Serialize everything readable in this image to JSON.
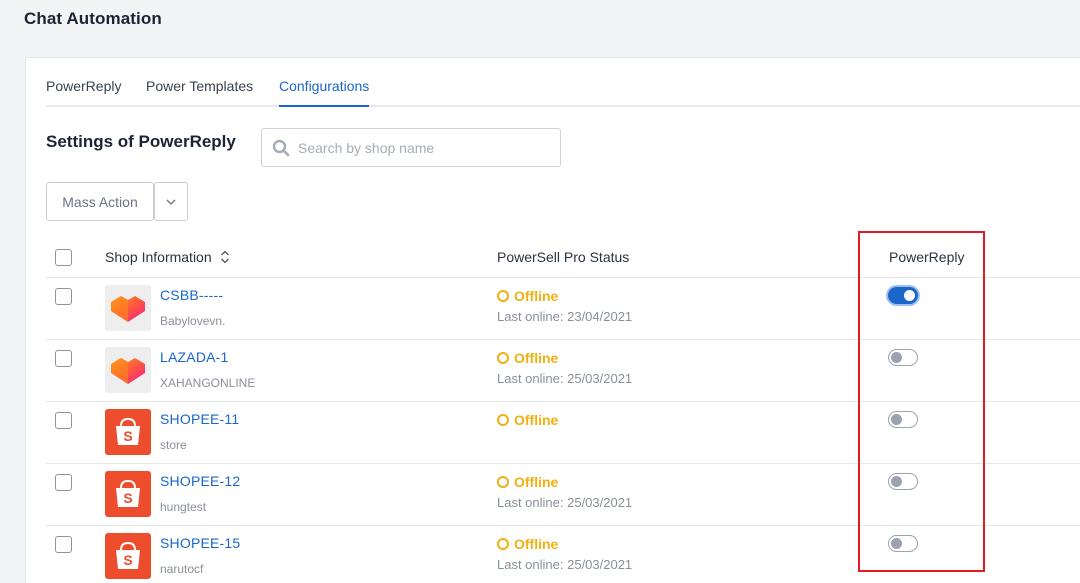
{
  "page": {
    "title": "Chat Automation"
  },
  "tabs": [
    {
      "label": "PowerReply",
      "active": false
    },
    {
      "label": "Power Templates",
      "active": false
    },
    {
      "label": "Configurations",
      "active": true
    }
  ],
  "section": {
    "title": "Settings of PowerReply"
  },
  "search": {
    "placeholder": "Search by shop name",
    "value": ""
  },
  "mass_action": {
    "label": "Mass Action"
  },
  "table": {
    "headers": {
      "shop_info": "Shop Information",
      "status": "PowerSell Pro Status",
      "power_reply": "PowerReply"
    },
    "rows": [
      {
        "name": "CSBB-----",
        "sub": "Babylovevn.",
        "platform": "lazada",
        "status": "Offline",
        "last_online": "Last online: 23/04/2021",
        "power_reply": true
      },
      {
        "name": "LAZADA-1",
        "sub": "XAHANGONLINE",
        "platform": "lazada",
        "status": "Offline",
        "last_online": "Last online: 25/03/2021",
        "power_reply": false
      },
      {
        "name": "SHOPEE-11",
        "sub": "store",
        "platform": "shopee",
        "status": "Offline",
        "last_online": "",
        "power_reply": false
      },
      {
        "name": "SHOPEE-12",
        "sub": "hungtest",
        "platform": "shopee",
        "status": "Offline",
        "last_online": "Last online: 25/03/2021",
        "power_reply": false
      },
      {
        "name": "SHOPEE-15",
        "sub": "narutocf",
        "platform": "shopee",
        "status": "Offline",
        "last_online": "Last online: 25/03/2021",
        "power_reply": false
      }
    ]
  },
  "colors": {
    "accent": "#1a66c9",
    "offline": "#f0b012",
    "highlight": "#e11b22",
    "shopee": "#ee4d2d"
  }
}
